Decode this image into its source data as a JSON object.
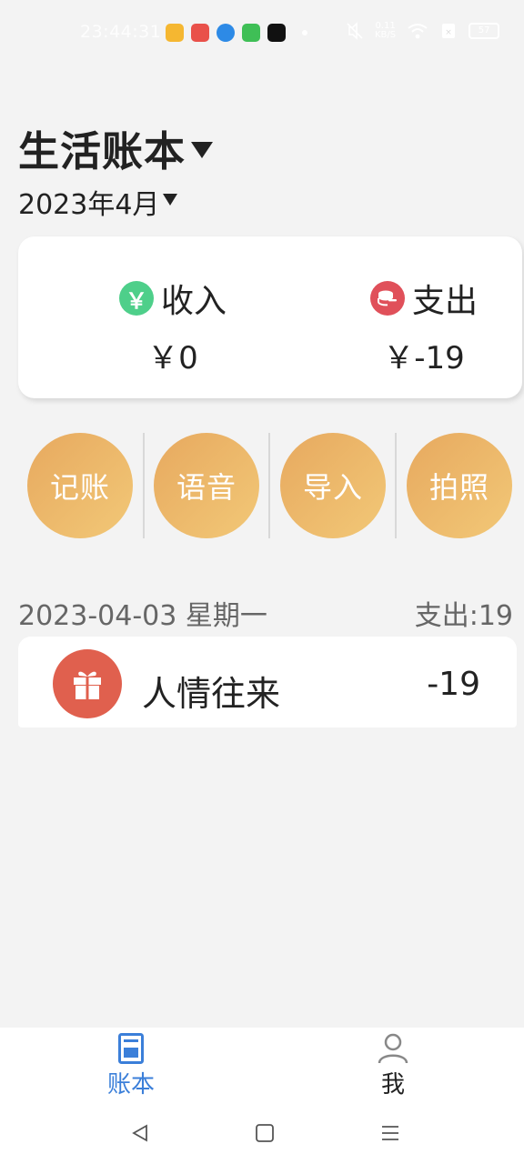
{
  "status_bar": {
    "time": "23:44:31",
    "network_speed_value": "0.11",
    "network_speed_unit": "KB/S",
    "battery": "57",
    "app_colors": [
      "#f5b731",
      "#e9514a",
      "#2d8ae6",
      "#3fbf56",
      "#111111"
    ]
  },
  "header": {
    "book_title": "生活账本",
    "month": "2023年4月"
  },
  "summary": {
    "income_label": "收入",
    "income_value": "￥0",
    "income_icon_glyph": "￥",
    "income_color": "#4ecf8a",
    "expense_label": "支出",
    "expense_value": "￥-19",
    "expense_color": "#e0505a"
  },
  "actions": [
    {
      "label": "记账"
    },
    {
      "label": "语音"
    },
    {
      "label": "导入"
    },
    {
      "label": "拍照"
    }
  ],
  "day_group": {
    "date": "2023-04-03 星期一",
    "total": "支出:19",
    "records": [
      {
        "category": "人情往来",
        "amount": "-19",
        "icon": "gift-icon",
        "color": "#e0604e"
      }
    ]
  },
  "bottom_nav": {
    "ledger_label": "账本",
    "me_label": "我",
    "active_color": "#3b7fd9"
  }
}
